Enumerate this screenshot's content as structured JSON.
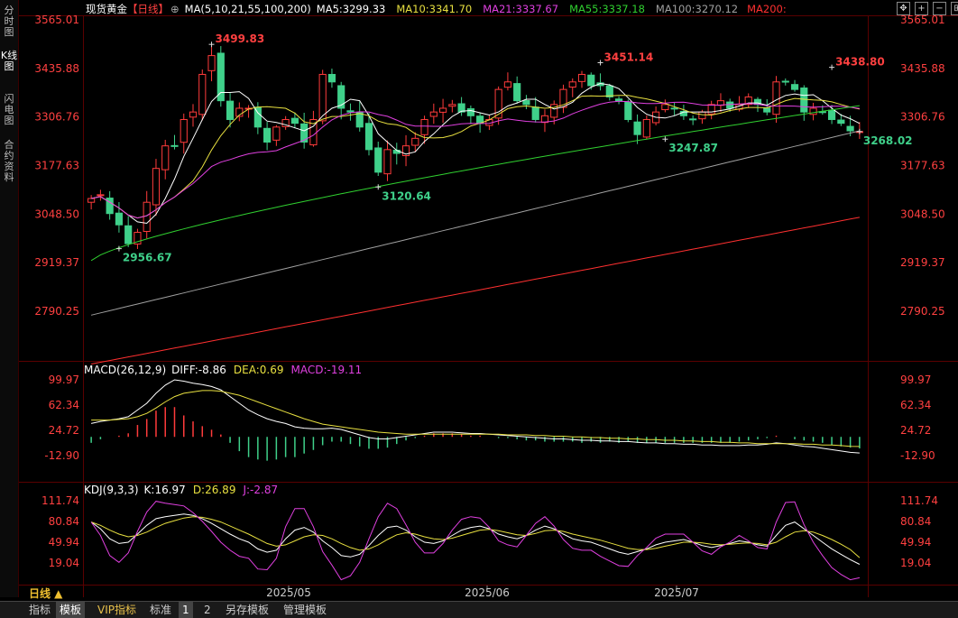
{
  "sidebar": {
    "items": [
      {
        "label": "分时图",
        "active": false
      },
      {
        "label": "K线图",
        "active": true
      },
      {
        "label": "闪电图",
        "active": false
      },
      {
        "label": "合约资料",
        "active": false
      }
    ]
  },
  "price_panel": {
    "symbol": "现货黄金",
    "period_tag": "【日线】",
    "ma_header": "MA(5,10,21,55,100,200)",
    "ma5": "MA5:3299.33",
    "ma10": "MA10:3341.70",
    "ma21": "MA21:3337.67",
    "ma55": "MA55:3337.18",
    "ma100": "MA100:3270.12",
    "ma200": "MA200:"
  },
  "macd_panel": {
    "title": "MACD(26,12,9)",
    "diff": "DIFF:-8.86",
    "dea": "DEA:0.69",
    "macd": "MACD:-19.11"
  },
  "kdj_panel": {
    "title": "KDJ(9,3,3)",
    "k": "K:16.97",
    "d": "D:26.89",
    "j": "J:-2.87"
  },
  "x_axis_labels": [
    "2025/05",
    "2025/06",
    "2025/07"
  ],
  "period_selector": "日线 ▲",
  "bottom_tabs": [
    {
      "label": "指标",
      "active": false,
      "vip": false
    },
    {
      "label": "模板",
      "active": true,
      "vip": false
    },
    {
      "label": "VIP指标",
      "active": false,
      "vip": true
    },
    {
      "label": "标准",
      "active": false,
      "vip": false
    },
    {
      "label": "1",
      "active": true,
      "vip": false
    },
    {
      "label": "2",
      "active": false,
      "vip": false
    },
    {
      "label": "另存模板",
      "active": false,
      "vip": false
    },
    {
      "label": "管理模板",
      "active": false,
      "vip": false
    }
  ],
  "colors": {
    "up": "#ff3b3b",
    "down": "#3fd08a",
    "axis_red": "#ff4040",
    "ma5": "#ffffff",
    "ma10": "#e8e040",
    "ma21": "#e040e0",
    "ma55": "#30d030",
    "ma100": "#a0a0a0",
    "ma200": "#ff3030"
  },
  "chart_data": [
    {
      "type": "candlestick",
      "title": "现货黄金【日线】",
      "y_ticks": [
        3565.01,
        3435.88,
        3306.76,
        3177.63,
        3048.5,
        2919.37,
        2790.25
      ],
      "ylim": [
        2750,
        3590
      ],
      "annotations": [
        {
          "label": "3499.83",
          "value": 3499.83,
          "kind": "high"
        },
        {
          "label": "2956.67",
          "value": 2956.67,
          "kind": "low"
        },
        {
          "label": "3120.64",
          "value": 3120.64,
          "kind": "low"
        },
        {
          "label": "3451.14",
          "value": 3451.14,
          "kind": "high"
        },
        {
          "label": "3247.87",
          "value": 3247.87,
          "kind": "low"
        },
        {
          "label": "3438.80",
          "value": 3438.8,
          "kind": "high"
        },
        {
          "label": "3268.02",
          "value": 3268.02,
          "kind": "low"
        }
      ],
      "close_path": [
        3090,
        3100,
        3050,
        3020,
        2970,
        3000,
        3080,
        3170,
        3230,
        3230,
        3300,
        3320,
        3420,
        3470,
        3350,
        3300,
        3330,
        3330,
        3280,
        3240,
        3280,
        3300,
        3290,
        3240,
        3300,
        3420,
        3400,
        3330,
        3320,
        3280,
        3220,
        3160,
        3220,
        3210,
        3230,
        3250,
        3300,
        3320,
        3330,
        3340,
        3320,
        3310,
        3290,
        3300,
        3380,
        3400,
        3350,
        3340,
        3300,
        3310,
        3340,
        3380,
        3400,
        3420,
        3390,
        3390,
        3360,
        3350,
        3300,
        3260,
        3300,
        3320,
        3340,
        3330,
        3310,
        3300,
        3320,
        3340,
        3350,
        3330,
        3340,
        3360,
        3340,
        3320,
        3400,
        3400,
        3380,
        3320,
        3330,
        3320,
        3300,
        3290,
        3270,
        3268
      ]
    },
    {
      "type": "line",
      "title": "MACD(26,12,9)",
      "series": [
        {
          "name": "DIFF",
          "last": -8.86
        },
        {
          "name": "DEA",
          "last": 0.69
        },
        {
          "name": "MACD",
          "last": -19.11
        }
      ],
      "y_ticks": [
        99.97,
        62.34,
        24.72,
        -12.9
      ],
      "diff_path": [
        35,
        38,
        40,
        42,
        45,
        55,
        65,
        80,
        92,
        100,
        98,
        95,
        93,
        90,
        85,
        75,
        65,
        55,
        48,
        42,
        38,
        35,
        30,
        28,
        27,
        27,
        28,
        26,
        22,
        18,
        14,
        12,
        12,
        14,
        16,
        18,
        20,
        22,
        22,
        22,
        21,
        20,
        20,
        19,
        18,
        17,
        16,
        15,
        14,
        13,
        12,
        12,
        11,
        10,
        10,
        9,
        9,
        8,
        8,
        7,
        6,
        6,
        5,
        5,
        4,
        4,
        3,
        3,
        2,
        2,
        2,
        3,
        3,
        4,
        6,
        5,
        3,
        1,
        0,
        -2,
        -4,
        -6,
        -8,
        -9
      ],
      "dea_path": [
        40,
        40,
        40,
        41,
        42,
        45,
        50,
        58,
        67,
        75,
        80,
        82,
        84,
        84,
        83,
        80,
        77,
        72,
        67,
        62,
        57,
        52,
        47,
        42,
        38,
        34,
        32,
        30,
        28,
        26,
        24,
        22,
        21,
        20,
        19,
        19,
        19,
        19,
        19,
        19,
        19,
        19,
        19,
        19,
        19,
        18,
        18,
        18,
        17,
        17,
        16,
        16,
        15,
        15,
        14,
        14,
        13,
        13,
        12,
        12,
        11,
        11,
        10,
        10,
        9,
        9,
        8,
        8,
        7,
        7,
        6,
        6,
        5,
        5,
        5,
        5,
        5,
        4,
        4,
        3,
        3,
        2,
        1,
        0.7
      ]
    },
    {
      "type": "line",
      "title": "KDJ(9,3,3)",
      "series": [
        {
          "name": "K",
          "last": 16.97
        },
        {
          "name": "D",
          "last": 26.89
        },
        {
          "name": "J",
          "last": -2.87
        }
      ],
      "y_ticks": [
        111.74,
        80.84,
        49.94,
        19.04
      ],
      "k_path": [
        80,
        70,
        55,
        48,
        50,
        62,
        75,
        85,
        88,
        90,
        92,
        90,
        85,
        78,
        70,
        62,
        55,
        50,
        40,
        35,
        38,
        55,
        68,
        72,
        65,
        52,
        42,
        30,
        28,
        32,
        45,
        60,
        72,
        74,
        68,
        58,
        50,
        48,
        52,
        60,
        68,
        72,
        74,
        70,
        62,
        58,
        55,
        60,
        68,
        74,
        70,
        62,
        55,
        52,
        50,
        45,
        40,
        35,
        32,
        36,
        40,
        46,
        50,
        52,
        54,
        50,
        45,
        42,
        45,
        48,
        52,
        50,
        46,
        44,
        60,
        75,
        80,
        70,
        60,
        50,
        40,
        32,
        24,
        17
      ],
      "d_path": [
        80,
        75,
        68,
        62,
        58,
        60,
        65,
        72,
        78,
        82,
        86,
        88,
        87,
        84,
        80,
        74,
        68,
        62,
        55,
        48,
        44,
        46,
        52,
        58,
        61,
        60,
        55,
        48,
        42,
        38,
        40,
        46,
        54,
        61,
        64,
        62,
        58,
        55,
        54,
        56,
        60,
        64,
        68,
        69,
        67,
        64,
        61,
        60,
        63,
        67,
        68,
        66,
        62,
        59,
        56,
        53,
        49,
        45,
        41,
        39,
        39,
        41,
        44,
        47,
        50,
        50,
        49,
        47,
        46,
        47,
        48,
        49,
        48,
        46,
        50,
        58,
        65,
        67,
        65,
        60,
        54,
        47,
        39,
        27
      ],
      "j_path": [
        80,
        60,
        30,
        20,
        34,
        66,
        95,
        111,
        108,
        106,
        104,
        94,
        81,
        66,
        50,
        38,
        29,
        26,
        10,
        9,
        26,
        73,
        100,
        100,
        73,
        36,
        16,
        -6,
        0,
        20,
        55,
        88,
        108,
        100,
        76,
        50,
        34,
        34,
        48,
        68,
        84,
        88,
        86,
        72,
        52,
        46,
        43,
        60,
        78,
        88,
        74,
        54,
        41,
        38,
        38,
        29,
        22,
        15,
        14,
        30,
        42,
        56,
        62,
        62,
        62,
        50,
        37,
        32,
        43,
        50,
        60,
        52,
        42,
        40,
        80,
        109,
        110,
        76,
        50,
        30,
        12,
        2,
        -6,
        -3
      ]
    }
  ]
}
